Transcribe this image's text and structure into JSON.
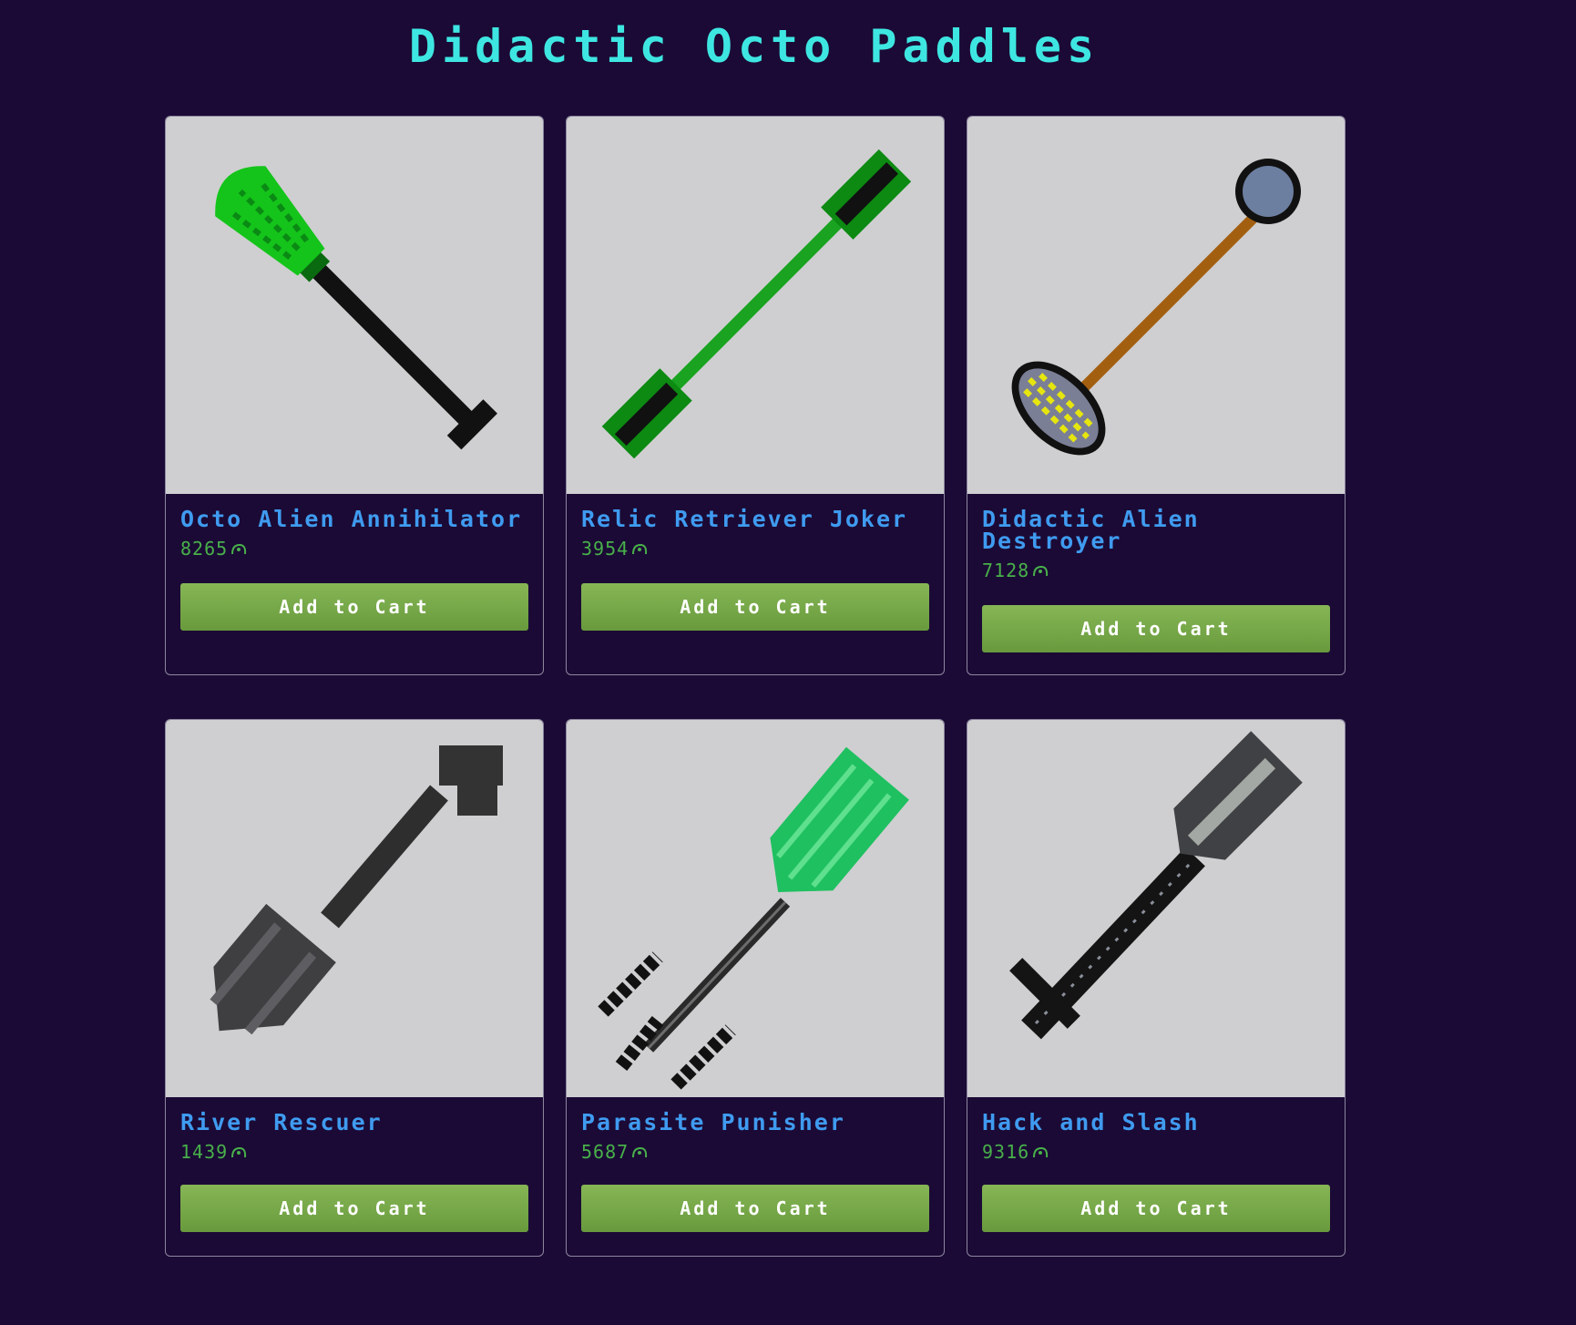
{
  "page": {
    "title": "Didactic Octo Paddles"
  },
  "currency_icon": "coin-icon",
  "colors": {
    "background": "#1b0a35",
    "title": "#3ee6e2",
    "product_name": "#3f9bf0",
    "price": "#48b04a",
    "button": "#7aab4a",
    "card_image_bg": "#cfcfd1"
  },
  "products": [
    {
      "name": "Octo Alien Annihilator",
      "price": "8265",
      "button_label": "Add to Cart",
      "image_icon": "green-paddle-icon"
    },
    {
      "name": "Relic Retriever Joker",
      "price": "3954",
      "button_label": "Add to Cart",
      "image_icon": "double-green-paddle-icon"
    },
    {
      "name": "Didactic Alien Destroyer",
      "price": "7128",
      "button_label": "Add to Cart",
      "image_icon": "blue-yellow-paddle-icon"
    },
    {
      "name": "River Rescuer",
      "price": "1439",
      "button_label": "Add to Cart",
      "image_icon": "gray-paddle-icon"
    },
    {
      "name": "Parasite Punisher",
      "price": "5687",
      "button_label": "Add to Cart",
      "image_icon": "emerald-paddle-icon"
    },
    {
      "name": "Hack and Slash",
      "price": "9316",
      "button_label": "Add to Cart",
      "image_icon": "dark-blade-paddle-icon"
    }
  ]
}
